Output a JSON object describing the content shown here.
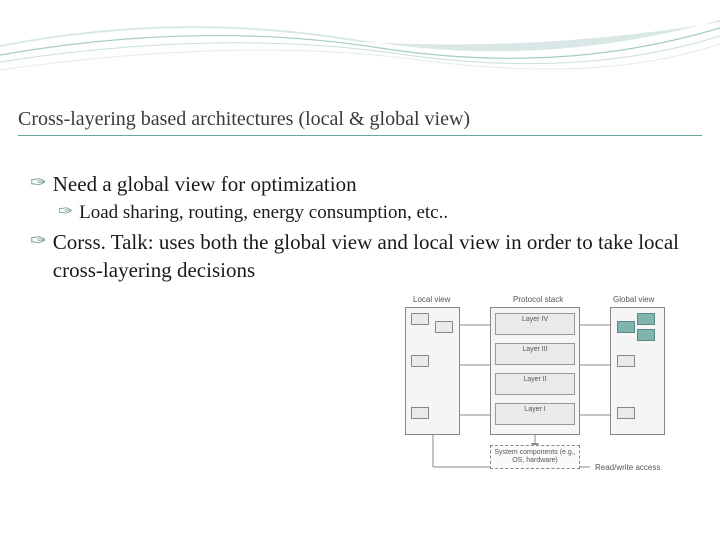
{
  "title": "Cross-layering based architectures (local & global view)",
  "bullets": [
    {
      "level": 1,
      "text": "Need a global view for optimization"
    },
    {
      "level": 2,
      "text": "Load sharing, routing, energy consumption, etc.."
    },
    {
      "level": 1,
      "text": "Corss. Talk: uses both the global view and local view in order to take local cross-layering decisions"
    }
  ],
  "diagram": {
    "headers": {
      "left": "Local view",
      "mid": "Protocol stack",
      "right": "Global view"
    },
    "layers": [
      "Layer IV",
      "Layer III",
      "Layer II",
      "Layer I"
    ],
    "sysbox": "System components (e.g., OS, hardware)",
    "footer": "Read/write access"
  }
}
